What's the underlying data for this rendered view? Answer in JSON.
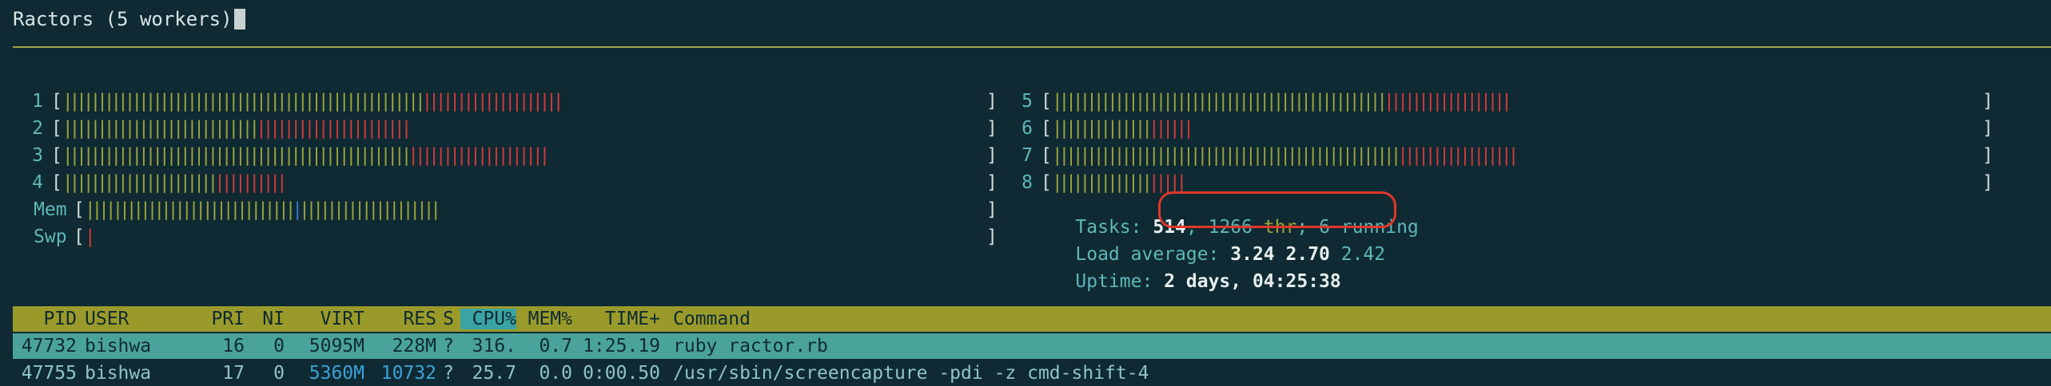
{
  "top_partial_line": "…",
  "title": "Ractors (5 workers)",
  "meters_left": [
    {
      "label": "1",
      "green": 52,
      "red": 20
    },
    {
      "label": "2",
      "green": 28,
      "red": 22
    },
    {
      "label": "3",
      "green": 50,
      "red": 20
    },
    {
      "label": "4",
      "green": 22,
      "red": 10
    }
  ],
  "meters_right": [
    {
      "label": "5",
      "green": 48,
      "red": 18
    },
    {
      "label": "6",
      "green": 14,
      "red": 6
    },
    {
      "label": "7",
      "green": 50,
      "red": 17
    },
    {
      "label": "8",
      "green": 14,
      "red": 5
    }
  ],
  "mem": {
    "label": "Mem",
    "green1": 30,
    "blue": 1,
    "green2": 20
  },
  "swp": {
    "label": "Swp",
    "red": 1
  },
  "tasks": {
    "label": "Tasks:",
    "count": "514",
    "sep": ",",
    "thr_num": "1266",
    "thr_label": "thr",
    "semi": ";",
    "running_num": "6",
    "running_label": "running"
  },
  "load": {
    "label": "Load average:",
    "v1": "3.24",
    "v2": "2.70",
    "v3": "2.42"
  },
  "uptime": {
    "label": "Uptime:",
    "value": "2 days, 04:25:38"
  },
  "columns": {
    "pid": "PID",
    "user": "USER",
    "pri": "PRI",
    "ni": "NI",
    "virt": "VIRT",
    "res": "RES",
    "s": "S",
    "cpu": "CPU%",
    "mem": "MEM%",
    "time": "TIME+",
    "cmd": "Command"
  },
  "processes": [
    {
      "pid": "47732",
      "user": "bishwa",
      "pri": "16",
      "ni": "0",
      "virt": "5095M",
      "res": "228M",
      "s": "?",
      "cpu": "316.",
      "mem": "0.7",
      "time": "1:25.19",
      "cmd": "ruby ractor.rb"
    },
    {
      "pid": "47755",
      "user": "bishwa",
      "pri": "17",
      "ni": "0",
      "virt": "5360M",
      "res": "10732",
      "s": "?",
      "cpu": "25.7",
      "mem": "0.0",
      "time": "0:00.50",
      "cmd": "/usr/sbin/screencapture -pdi -z cmd-shift-4"
    }
  ],
  "colors": {
    "background": "#0f2a33",
    "bar_green": "#9aa43c",
    "bar_red": "#d23a3a",
    "header_bg": "#9a9a2a",
    "selected_bg": "#4aa39a",
    "annotation": "#e0372a"
  }
}
